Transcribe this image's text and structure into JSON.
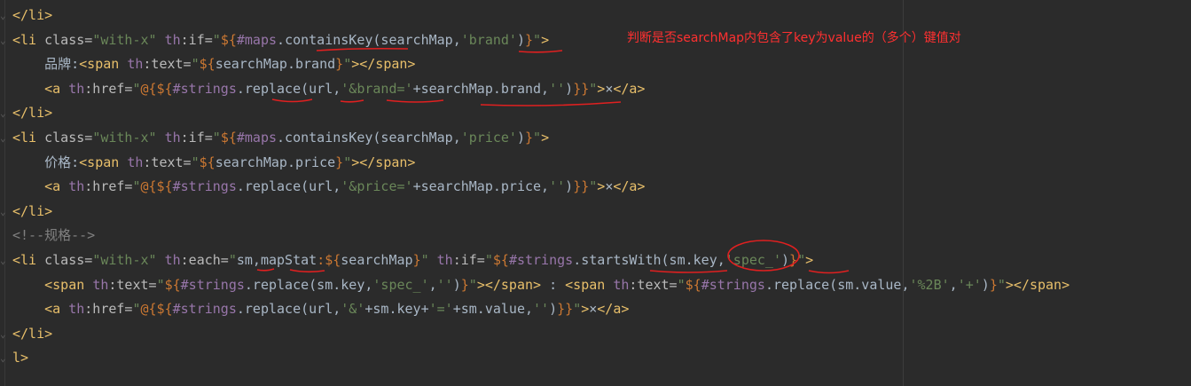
{
  "editor": {
    "lines": [
      {
        "indent": "",
        "parts": [
          [
            "tag",
            "</li>"
          ]
        ]
      },
      {
        "indent": "",
        "parts": [
          [
            "tag",
            "<li "
          ],
          [
            "attr",
            "class="
          ],
          [
            "str",
            "\"with-x\""
          ],
          [
            "attr",
            " "
          ],
          [
            "ns",
            "th"
          ],
          [
            "attr",
            ":if="
          ],
          [
            "str",
            "\""
          ],
          [
            "expr",
            "${"
          ],
          [
            "obj",
            "#maps"
          ],
          [
            "sym",
            "."
          ],
          [
            "fn",
            "containsKey"
          ],
          [
            "sym",
            "(searchMap,"
          ],
          [
            "str",
            "'brand'"
          ],
          [
            "sym",
            ")"
          ],
          [
            "expr",
            "}"
          ],
          [
            "str",
            "\""
          ],
          [
            "tag",
            ">"
          ]
        ]
      },
      {
        "indent": "    ",
        "parts": [
          [
            "sym",
            "品牌:"
          ],
          [
            "tag",
            "<span "
          ],
          [
            "ns",
            "th"
          ],
          [
            "attr",
            ":text="
          ],
          [
            "str",
            "\""
          ],
          [
            "expr",
            "${"
          ],
          [
            "sym",
            "searchMap.brand"
          ],
          [
            "expr",
            "}"
          ],
          [
            "str",
            "\""
          ],
          [
            "tag",
            "></span>"
          ]
        ]
      },
      {
        "indent": "    ",
        "parts": [
          [
            "tag",
            "<a "
          ],
          [
            "ns",
            "th"
          ],
          [
            "attr",
            ":href="
          ],
          [
            "str",
            "\""
          ],
          [
            "expr",
            "@{${"
          ],
          [
            "obj",
            "#strings"
          ],
          [
            "sym",
            ".replace(url,"
          ],
          [
            "str",
            "'&brand='"
          ],
          [
            "sym",
            "+searchMap.brand,"
          ],
          [
            "str",
            "''"
          ],
          [
            "sym",
            ")"
          ],
          [
            "expr",
            "}}"
          ],
          [
            "str",
            "\""
          ],
          [
            "tag",
            ">"
          ],
          [
            "sym",
            "×"
          ],
          [
            "tag",
            "</a>"
          ]
        ]
      },
      {
        "indent": "",
        "parts": [
          [
            "tag",
            "</li>"
          ]
        ]
      },
      {
        "indent": "",
        "parts": [
          [
            "tag",
            "<li "
          ],
          [
            "attr",
            "class="
          ],
          [
            "str",
            "\"with-x\""
          ],
          [
            "attr",
            " "
          ],
          [
            "ns",
            "th"
          ],
          [
            "attr",
            ":if="
          ],
          [
            "str",
            "\""
          ],
          [
            "expr",
            "${"
          ],
          [
            "obj",
            "#maps"
          ],
          [
            "sym",
            ".containsKey(searchMap,"
          ],
          [
            "str",
            "'price'"
          ],
          [
            "sym",
            ")"
          ],
          [
            "expr",
            "}"
          ],
          [
            "str",
            "\""
          ],
          [
            "tag",
            ">"
          ]
        ]
      },
      {
        "indent": "    ",
        "parts": [
          [
            "sym",
            "价格:"
          ],
          [
            "tag",
            "<span "
          ],
          [
            "ns",
            "th"
          ],
          [
            "attr",
            ":text="
          ],
          [
            "str",
            "\""
          ],
          [
            "expr",
            "${"
          ],
          [
            "sym",
            "searchMap.price"
          ],
          [
            "expr",
            "}"
          ],
          [
            "str",
            "\""
          ],
          [
            "tag",
            "></span>"
          ]
        ]
      },
      {
        "indent": "    ",
        "parts": [
          [
            "tag",
            "<a "
          ],
          [
            "ns",
            "th"
          ],
          [
            "attr",
            ":href="
          ],
          [
            "str",
            "\""
          ],
          [
            "expr",
            "@{${"
          ],
          [
            "obj",
            "#strings"
          ],
          [
            "sym",
            ".replace(url,"
          ],
          [
            "str",
            "'&price='"
          ],
          [
            "sym",
            "+searchMap.price,"
          ],
          [
            "str",
            "''"
          ],
          [
            "sym",
            ")"
          ],
          [
            "expr",
            "}}"
          ],
          [
            "str",
            "\""
          ],
          [
            "tag",
            ">"
          ],
          [
            "sym",
            "×"
          ],
          [
            "tag",
            "</a>"
          ]
        ]
      },
      {
        "indent": "",
        "parts": [
          [
            "tag",
            "</li>"
          ]
        ]
      },
      {
        "indent": "",
        "parts": [
          [
            "cmt",
            "<!--规格-->"
          ]
        ]
      },
      {
        "indent": "",
        "parts": [
          [
            "tag",
            "<li "
          ],
          [
            "attr",
            "class="
          ],
          [
            "str",
            "\"with-x\""
          ],
          [
            "attr",
            " "
          ],
          [
            "ns",
            "th"
          ],
          [
            "attr",
            ":each="
          ],
          [
            "str",
            "\""
          ],
          [
            "sym",
            "sm,mapStat"
          ],
          [
            "expr",
            ":${"
          ],
          [
            "sym",
            "searchMap"
          ],
          [
            "expr",
            "}"
          ],
          [
            "str",
            "\""
          ],
          [
            "attr",
            " "
          ],
          [
            "ns",
            "th"
          ],
          [
            "attr",
            ":if="
          ],
          [
            "str",
            "\""
          ],
          [
            "expr",
            "${"
          ],
          [
            "obj",
            "#strings"
          ],
          [
            "sym",
            ".startsWith(sm.key,"
          ],
          [
            "str",
            "'spec_'"
          ],
          [
            "sym",
            ")"
          ],
          [
            "expr",
            "}"
          ],
          [
            "str",
            "\""
          ],
          [
            "tag",
            ">"
          ]
        ]
      },
      {
        "indent": "    ",
        "parts": [
          [
            "tag",
            "<span "
          ],
          [
            "ns",
            "th"
          ],
          [
            "attr",
            ":text="
          ],
          [
            "str",
            "\""
          ],
          [
            "expr",
            "${"
          ],
          [
            "obj",
            "#strings"
          ],
          [
            "sym",
            ".replace(sm.key,"
          ],
          [
            "str",
            "'spec_'"
          ],
          [
            "sym",
            ","
          ],
          [
            "str",
            "''"
          ],
          [
            "sym",
            ")"
          ],
          [
            "expr",
            "}"
          ],
          [
            "str",
            "\""
          ],
          [
            "tag",
            "></span>"
          ],
          [
            "sym",
            " : "
          ],
          [
            "tag",
            "<span "
          ],
          [
            "ns",
            "th"
          ],
          [
            "attr",
            ":text="
          ],
          [
            "str",
            "\""
          ],
          [
            "expr",
            "${"
          ],
          [
            "obj",
            "#strings"
          ],
          [
            "sym",
            ".replace(sm.value,"
          ],
          [
            "str",
            "'%2B'"
          ],
          [
            "sym",
            ","
          ],
          [
            "str",
            "'+'"
          ],
          [
            "sym",
            ")"
          ],
          [
            "expr",
            "}"
          ],
          [
            "str",
            "\""
          ],
          [
            "tag",
            "></span>"
          ]
        ]
      },
      {
        "indent": "    ",
        "parts": [
          [
            "tag",
            "<a "
          ],
          [
            "ns",
            "th"
          ],
          [
            "attr",
            ":href="
          ],
          [
            "str",
            "\""
          ],
          [
            "expr",
            "@{${"
          ],
          [
            "obj",
            "#strings"
          ],
          [
            "sym",
            ".replace(url,"
          ],
          [
            "str",
            "'&'"
          ],
          [
            "sym",
            "+sm.key+"
          ],
          [
            "str",
            "'='"
          ],
          [
            "sym",
            "+sm.value,"
          ],
          [
            "str",
            "''"
          ],
          [
            "sym",
            ")"
          ],
          [
            "expr",
            "}}"
          ],
          [
            "str",
            "\""
          ],
          [
            "tag",
            ">"
          ],
          [
            "sym",
            "×"
          ],
          [
            "tag",
            "</a>"
          ]
        ]
      },
      {
        "indent": "",
        "parts": [
          [
            "tag",
            "</li>"
          ]
        ]
      },
      {
        "indent": "",
        "parts": [
          [
            "tag",
            "l>"
          ]
        ]
      }
    ]
  },
  "annotation": {
    "text": "判断是否searchMap内包含了key为value的（多个）键值对",
    "color": "#ff3030"
  },
  "colors": {
    "background": "#2b2b2b",
    "tag": "#e8bf6a",
    "string": "#6a8759",
    "namespace": "#9876aa",
    "text": "#a9b7c6",
    "ink_marks": "#e02020"
  }
}
